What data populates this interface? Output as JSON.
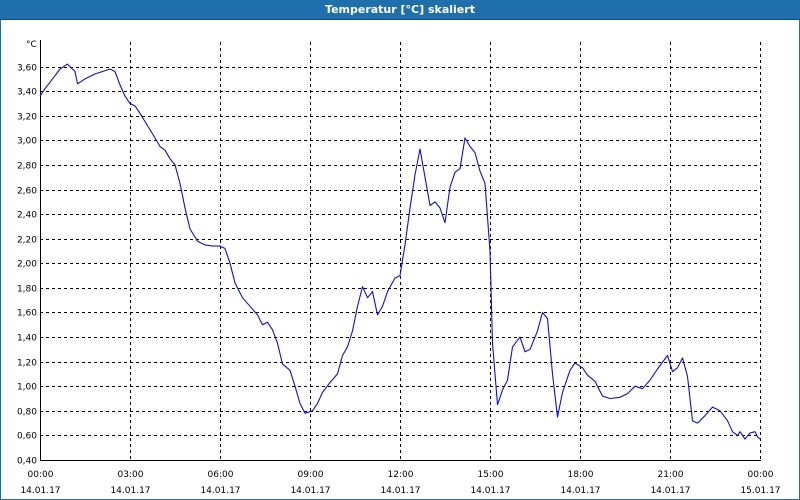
{
  "window": {
    "title": "Temperatur [°C] skaliert"
  },
  "colors": {
    "titlebar": "#1f6fad",
    "line": "#1010c8",
    "grid": "#000000",
    "background": "#ffffff"
  },
  "chart_data": {
    "type": "line",
    "title": "Temperatur [°C] skaliert",
    "ylabel": "°C",
    "xlabel": "",
    "ylim": [
      0.4,
      3.8
    ],
    "xlim": [
      0,
      24
    ],
    "grid": true,
    "grid_style": "dashed",
    "yticks": [
      "0,40",
      "0,60",
      "0,80",
      "1,00",
      "1,20",
      "1,40",
      "1,60",
      "1,80",
      "2,00",
      "2,20",
      "2,40",
      "2,60",
      "2,80",
      "3,00",
      "3,20",
      "3,40",
      "3,60"
    ],
    "xticks": [
      {
        "time": "00:00",
        "date": "14.01.17"
      },
      {
        "time": "03:00",
        "date": "14.01.17"
      },
      {
        "time": "06:00",
        "date": "14.01.17"
      },
      {
        "time": "09:00",
        "date": "14.01.17"
      },
      {
        "time": "12:00",
        "date": "14.01.17"
      },
      {
        "time": "15:00",
        "date": "14.01.17"
      },
      {
        "time": "18:00",
        "date": "14.01.17"
      },
      {
        "time": "21:00",
        "date": "14.01.17"
      },
      {
        "time": "00:00",
        "date": "15.01.17"
      }
    ],
    "series": [
      {
        "points": [
          [
            "14.01.17 00:00",
            3.36
          ],
          [
            "14.01.17 00:10",
            3.42
          ],
          [
            "14.01.17 00:25",
            3.5
          ],
          [
            "14.01.17 00:40",
            3.58
          ],
          [
            "14.01.17 00:55",
            3.62
          ],
          [
            "14.01.17 01:10",
            3.56
          ],
          [
            "14.01.17 01:15",
            3.46
          ],
          [
            "14.01.17 01:30",
            3.5
          ],
          [
            "14.01.17 01:50",
            3.54
          ],
          [
            "14.01.17 02:05",
            3.56
          ],
          [
            "14.01.17 02:20",
            3.58
          ],
          [
            "14.01.17 02:30",
            3.56
          ],
          [
            "14.01.17 02:40",
            3.45
          ],
          [
            "14.01.17 02:50",
            3.36
          ],
          [
            "14.01.17 03:00",
            3.3
          ],
          [
            "14.01.17 03:10",
            3.28
          ],
          [
            "14.01.17 03:20",
            3.22
          ],
          [
            "14.01.17 03:35",
            3.12
          ],
          [
            "14.01.17 03:50",
            3.02
          ],
          [
            "14.01.17 04:00",
            2.95
          ],
          [
            "14.01.17 04:10",
            2.92
          ],
          [
            "14.01.17 04:20",
            2.85
          ],
          [
            "14.01.17 04:30",
            2.8
          ],
          [
            "14.01.17 04:40",
            2.65
          ],
          [
            "14.01.17 04:50",
            2.45
          ],
          [
            "14.01.17 05:00",
            2.28
          ],
          [
            "14.01.17 05:15",
            2.18
          ],
          [
            "14.01.17 05:30",
            2.15
          ],
          [
            "14.01.17 05:45",
            2.14
          ],
          [
            "14.01.17 06:00",
            2.14
          ],
          [
            "14.01.17 06:10",
            2.12
          ],
          [
            "14.01.17 06:20",
            2.0
          ],
          [
            "14.01.17 06:30",
            1.84
          ],
          [
            "14.01.17 06:45",
            1.72
          ],
          [
            "14.01.17 07:00",
            1.65
          ],
          [
            "14.01.17 07:15",
            1.58
          ],
          [
            "14.01.17 07:25",
            1.5
          ],
          [
            "14.01.17 07:35",
            1.52
          ],
          [
            "14.01.17 07:45",
            1.46
          ],
          [
            "14.01.17 07:55",
            1.35
          ],
          [
            "14.01.17 08:05",
            1.18
          ],
          [
            "14.01.17 08:20",
            1.13
          ],
          [
            "14.01.17 08:30",
            1.0
          ],
          [
            "14.01.17 08:40",
            0.86
          ],
          [
            "14.01.17 08:50",
            0.78
          ],
          [
            "14.01.17 09:05",
            0.8
          ],
          [
            "14.01.17 09:15",
            0.86
          ],
          [
            "14.01.17 09:25",
            0.95
          ],
          [
            "14.01.17 09:40",
            1.03
          ],
          [
            "14.01.17 09:55",
            1.1
          ],
          [
            "14.01.17 10:05",
            1.25
          ],
          [
            "14.01.17 10:15",
            1.32
          ],
          [
            "14.01.17 10:25",
            1.45
          ],
          [
            "14.01.17 10:35",
            1.65
          ],
          [
            "14.01.17 10:45",
            1.81
          ],
          [
            "14.01.17 10:55",
            1.72
          ],
          [
            "14.01.17 11:05",
            1.77
          ],
          [
            "14.01.17 11:15",
            1.58
          ],
          [
            "14.01.17 11:25",
            1.65
          ],
          [
            "14.01.17 11:35",
            1.77
          ],
          [
            "14.01.17 11:50",
            1.88
          ],
          [
            "14.01.17 12:00",
            1.9
          ],
          [
            "14.01.17 12:10",
            2.15
          ],
          [
            "14.01.17 12:20",
            2.45
          ],
          [
            "14.01.17 12:30",
            2.72
          ],
          [
            "14.01.17 12:40",
            2.93
          ],
          [
            "14.01.17 12:50",
            2.7
          ],
          [
            "14.01.17 13:00",
            2.47
          ],
          [
            "14.01.17 13:10",
            2.5
          ],
          [
            "14.01.17 13:20",
            2.45
          ],
          [
            "14.01.17 13:30",
            2.33
          ],
          [
            "14.01.17 13:40",
            2.62
          ],
          [
            "14.01.17 13:50",
            2.74
          ],
          [
            "14.01.17 14:00",
            2.77
          ],
          [
            "14.01.17 14:10",
            3.02
          ],
          [
            "14.01.17 14:20",
            2.95
          ],
          [
            "14.01.17 14:30",
            2.9
          ],
          [
            "14.01.17 14:40",
            2.75
          ],
          [
            "14.01.17 14:50",
            2.65
          ],
          [
            "14.01.17 15:00",
            2.1
          ],
          [
            "14.01.17 15:05",
            1.35
          ],
          [
            "14.01.17 15:15",
            0.85
          ],
          [
            "14.01.17 15:25",
            0.97
          ],
          [
            "14.01.17 15:35",
            1.05
          ],
          [
            "14.01.17 15:45",
            1.32
          ],
          [
            "14.01.17 16:00",
            1.4
          ],
          [
            "14.01.17 16:10",
            1.28
          ],
          [
            "14.01.17 16:20",
            1.3
          ],
          [
            "14.01.17 16:35",
            1.45
          ],
          [
            "14.01.17 16:45",
            1.6
          ],
          [
            "14.01.17 16:55",
            1.55
          ],
          [
            "14.01.17 17:05",
            1.1
          ],
          [
            "14.01.17 17:15",
            0.75
          ],
          [
            "14.01.17 17:25",
            0.95
          ],
          [
            "14.01.17 17:40",
            1.13
          ],
          [
            "14.01.17 17:50",
            1.19
          ],
          [
            "14.01.17 18:05",
            1.15
          ],
          [
            "14.01.17 18:15",
            1.09
          ],
          [
            "14.01.17 18:30",
            1.04
          ],
          [
            "14.01.17 18:45",
            0.92
          ],
          [
            "14.01.17 19:00",
            0.9
          ],
          [
            "14.01.17 19:20",
            0.91
          ],
          [
            "14.01.17 19:35",
            0.94
          ],
          [
            "14.01.17 19:50",
            1.0
          ],
          [
            "14.01.17 20:05",
            0.98
          ],
          [
            "14.01.17 20:20",
            1.05
          ],
          [
            "14.01.17 20:35",
            1.14
          ],
          [
            "14.01.17 20:55",
            1.25
          ],
          [
            "14.01.17 21:05",
            1.12
          ],
          [
            "14.01.17 21:15",
            1.15
          ],
          [
            "14.01.17 21:25",
            1.23
          ],
          [
            "14.01.17 21:35",
            1.08
          ],
          [
            "14.01.17 21:45",
            0.72
          ],
          [
            "14.01.17 21:55",
            0.7
          ],
          [
            "14.01.17 22:10",
            0.76
          ],
          [
            "14.01.17 22:25",
            0.83
          ],
          [
            "14.01.17 22:40",
            0.8
          ],
          [
            "14.01.17 22:55",
            0.72
          ],
          [
            "14.01.17 23:05",
            0.63
          ],
          [
            "14.01.17 23:15",
            0.6
          ],
          [
            "14.01.17 23:20",
            0.63
          ],
          [
            "14.01.17 23:30",
            0.57
          ],
          [
            "14.01.17 23:40",
            0.62
          ],
          [
            "14.01.17 23:50",
            0.63
          ],
          [
            "14.01.17 23:55",
            0.59
          ],
          [
            "15.01.17 00:00",
            0.57
          ]
        ]
      }
    ]
  }
}
